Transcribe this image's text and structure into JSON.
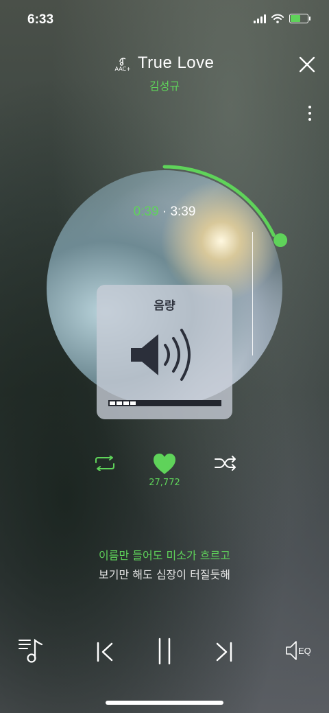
{
  "status_bar": {
    "time": "6:33"
  },
  "header": {
    "quality_badge": "AAC+",
    "song_title": "True Love",
    "artist": "김성규"
  },
  "player": {
    "current_time": "0:39",
    "separator": "·",
    "total_time": "3:39",
    "progress_fraction": 0.178,
    "like_count": "27,772"
  },
  "volume_hud": {
    "label": "음량",
    "level_segments": 4,
    "total_segments": 16
  },
  "lyrics": {
    "current_line": "이름만 들어도 미소가 흐르고",
    "next_line": "보기만 해도 심장이 터질듯해"
  },
  "bottom_bar": {
    "eq_label": "EQ"
  },
  "colors": {
    "accent": "#5fd35a",
    "text": "#ffffff"
  },
  "icons": [
    "signal-icon",
    "wifi-icon",
    "battery-icon",
    "aac-icon",
    "close-icon",
    "more-icon",
    "volume-icon",
    "repeat-icon",
    "heart-icon",
    "shuffle-icon",
    "playlist-icon",
    "prev-icon",
    "pause-icon",
    "next-icon",
    "eq-icon"
  ]
}
